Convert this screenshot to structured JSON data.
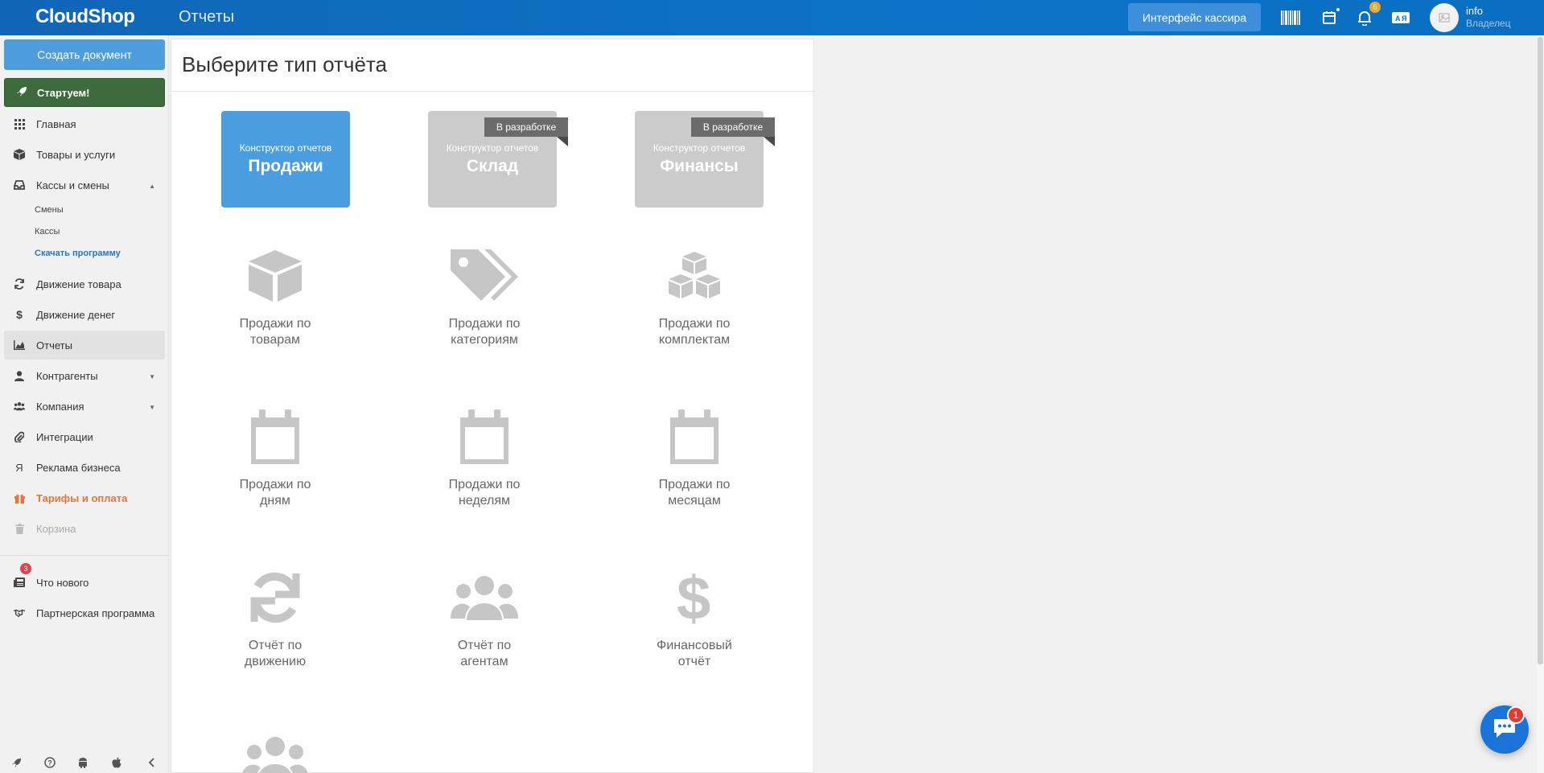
{
  "header": {
    "logo": "CloudShop",
    "page_title": "Отчеты",
    "cashier_button": "Интерфейс кассира",
    "notifications_count": "6",
    "user_name": "info",
    "user_role": "Владелец"
  },
  "sidebar": {
    "create_button": "Создать документ",
    "start_button": "Стартуем!",
    "items": {
      "home": "Главная",
      "goods": "Товары и услуги",
      "cashboxes": "Кассы и смены",
      "goods_movement": "Движение товара",
      "money_movement": "Движение денег",
      "reports": "Отчеты",
      "contractors": "Контрагенты",
      "company": "Компания",
      "integrations": "Интеграции",
      "ads": "Реклама бизнеса",
      "tariffs": "Тарифы и оплата",
      "trash": "Корзина",
      "whats_new": "Что нового",
      "partner": "Партнерская программа"
    },
    "sub_items": {
      "shifts": "Смены",
      "kassy": "Кассы",
      "download": "Скачать программу"
    },
    "whats_new_badge": "3"
  },
  "main": {
    "title": "Выберите тип отчёта",
    "tiles": [
      {
        "sub": "Конструктор отчетов",
        "big": "Продажи"
      },
      {
        "sub": "Конструктор отчетов",
        "big": "Склад",
        "ribbon": "В разработке"
      },
      {
        "sub": "Конструктор отчетов",
        "big": "Финансы",
        "ribbon": "В разработке"
      }
    ],
    "reports": [
      {
        "line1": "Продажи по",
        "line2": "товарам"
      },
      {
        "line1": "Продажи по",
        "line2": "категориям"
      },
      {
        "line1": "Продажи по",
        "line2": "комплектам"
      },
      {
        "line1": "Продажи по",
        "line2": "дням"
      },
      {
        "line1": "Продажи по",
        "line2": "неделям"
      },
      {
        "line1": "Продажи по",
        "line2": "месяцам"
      },
      {
        "line1": "Отчёт по",
        "line2": "движению"
      },
      {
        "line1": "Отчёт по",
        "line2": "агентам"
      },
      {
        "line1": "Финансовый",
        "line2": "отчёт"
      }
    ]
  },
  "chat": {
    "badge": "1"
  },
  "colors": {
    "accent_blue": "#4a9ee0",
    "header_blue": "#0b73c7",
    "start_green": "#3d6b3d",
    "tariffs_orange": "#e8743b"
  }
}
